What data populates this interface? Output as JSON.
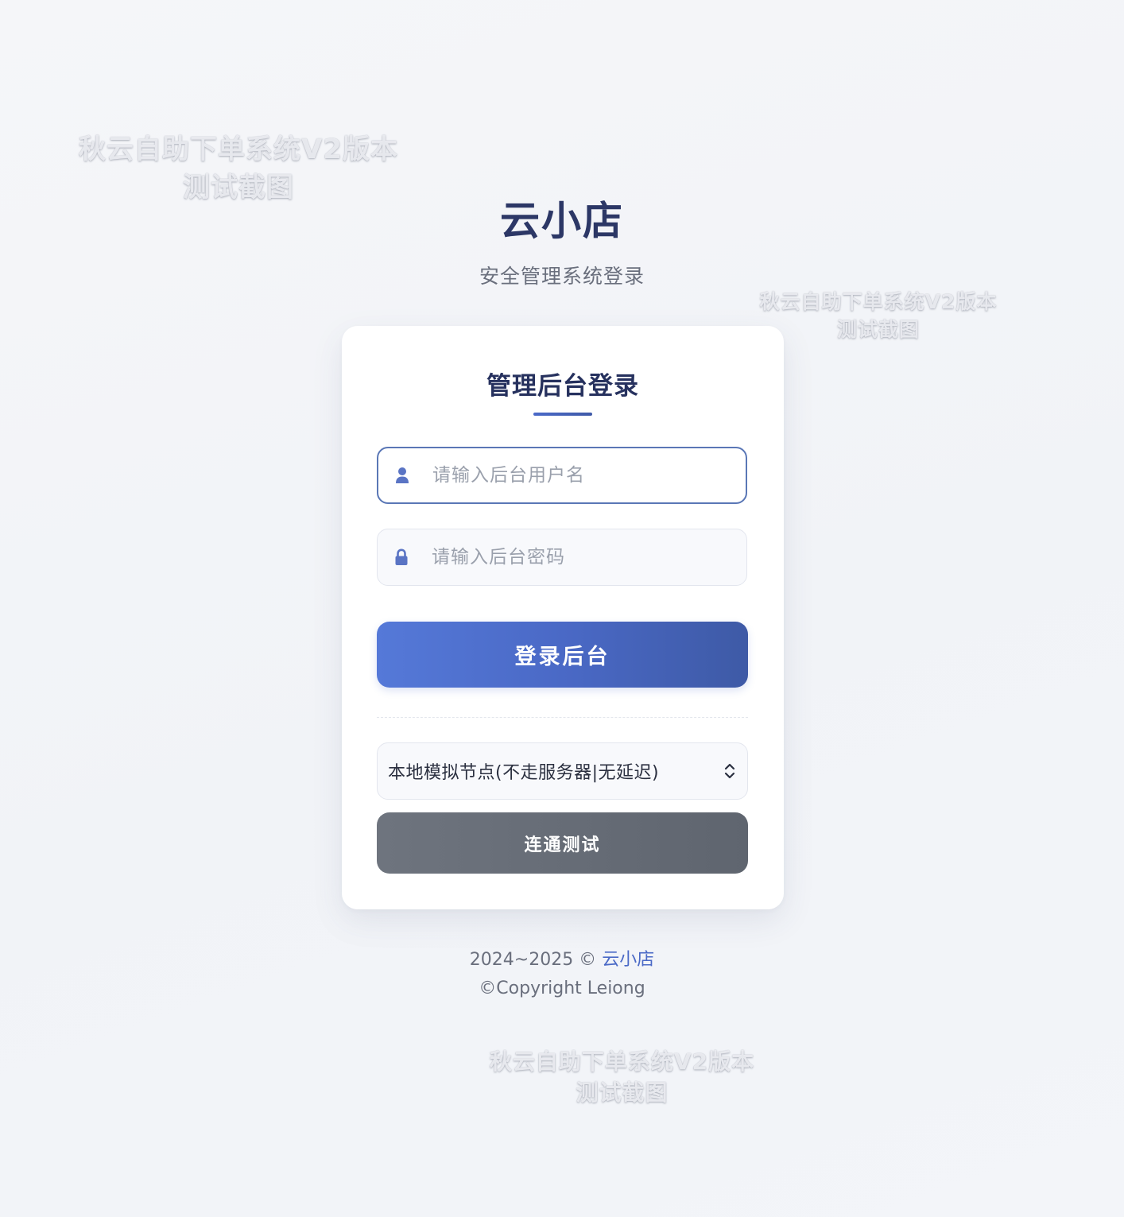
{
  "watermark": {
    "line1": "秋云自助下单系统V2版本",
    "line2": "测试截图"
  },
  "brand": {
    "title": "云小店",
    "subtitle": "安全管理系统登录"
  },
  "login_card": {
    "title": "管理后台登录",
    "username": {
      "placeholder": "请输入后台用户名",
      "value": "",
      "icon": "user-icon"
    },
    "password": {
      "placeholder": "请输入后台密码",
      "value": "",
      "icon": "lock-icon"
    },
    "login_button": "登录后台",
    "node_select": {
      "selected": "本地模拟节点(不走服务器|无延迟)",
      "icon": "chevron-up-down-icon"
    },
    "test_button": "连通测试"
  },
  "footer": {
    "years": "2024~2025 ©",
    "site_link": "云小店",
    "copyright": "©Copyright Leiong"
  },
  "colors": {
    "accent": "#4a69c6",
    "title": "#2c3766",
    "gray_button": "#666c76"
  }
}
